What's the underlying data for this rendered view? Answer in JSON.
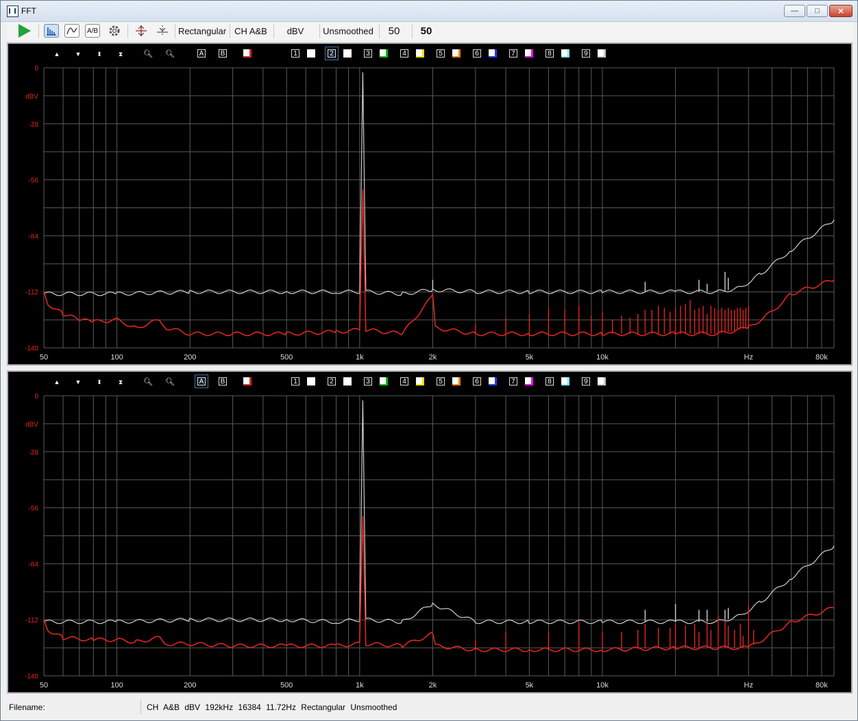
{
  "window": {
    "title": "FFT",
    "minimize": "—",
    "maximize": "□",
    "close": "✕"
  },
  "toolbar": {
    "play_icon": "play-icon",
    "window_fn": "Rectangular",
    "channel": "CH A&B",
    "units": "dBV",
    "smoothing": "Unsmoothed",
    "averages": "50",
    "averages_count": "50",
    "ab_label": "A/B"
  },
  "pane_toolbar": {
    "a": "A",
    "b": "B",
    "slots": [
      "1",
      "2",
      "3",
      "4",
      "5",
      "6",
      "7",
      "8",
      "9"
    ],
    "slot_colors": [
      "#ffffff",
      "#ffffff",
      "#00c000",
      "#f0e000",
      "#ff7f00",
      "#1e3cff",
      "#ff00ff",
      "#7fe8ff",
      "#c8c8c8"
    ]
  },
  "colors": {
    "trace_a": "#e0261f",
    "trace_b": "#cfcfcf",
    "grid": "#5a5a5a",
    "plot_bg": "#000000"
  },
  "chart_data": [
    {
      "type": "line",
      "title": "",
      "ylabel": "dBV",
      "xlabel": "Hz",
      "x_scale": "log",
      "xlim": [
        50,
        90000
      ],
      "ylim": [
        -140,
        0
      ],
      "y_ticks": [
        "0",
        "-28",
        "-56",
        "-84",
        "-112",
        "-140"
      ],
      "x_ticks": [
        "50",
        "100",
        "200",
        "500",
        "1k",
        "2k",
        "5k",
        "10k",
        "Hz",
        "80k"
      ],
      "series": [
        {
          "color": "#cfcfcf",
          "x": [
            50,
            100,
            200,
            500,
            800,
            1000,
            1030,
            1060,
            1500,
            2000,
            3000,
            5000,
            10000,
            20000,
            30000,
            37000,
            45000,
            60000,
            90000
          ],
          "y": [
            -113,
            -113,
            -112,
            -112,
            -112,
            -112,
            -2,
            -112,
            -113,
            -111,
            -112,
            -112,
            -112,
            -112,
            -112,
            -110,
            -103,
            -91,
            -76
          ],
          "spikes": [
            [
              2000,
              -106
            ],
            [
              15000,
              -107
            ],
            [
              25000,
              -106
            ],
            [
              27000,
              -108
            ],
            [
              32000,
              -102
            ],
            [
              33000,
              -105
            ]
          ]
        },
        {
          "color": "#e0261f",
          "x": [
            50,
            52,
            60,
            70,
            80,
            100,
            120,
            150,
            160,
            200,
            300,
            500,
            800,
            1000,
            1030,
            1060,
            1500,
            2000,
            2050,
            3000,
            5000,
            10000,
            20000,
            30000,
            40000,
            50000,
            60000,
            90000
          ],
          "y": [
            -112,
            -118,
            -123,
            -126,
            -127,
            -126,
            -130,
            -126,
            -130,
            -133,
            -133,
            -133,
            -132,
            -131,
            -60,
            -131,
            -133,
            -114,
            -130,
            -133,
            -133,
            -133,
            -133,
            -133,
            -130,
            -122,
            -113,
            -106
          ],
          "spikes": [
            [
              3000,
              -128
            ],
            [
              4000,
              -125
            ],
            [
              5000,
              -123
            ],
            [
              6000,
              -120
            ],
            [
              7000,
              -121
            ],
            [
              8000,
              -119
            ],
            [
              9000,
              -124
            ],
            [
              10000,
              -122
            ],
            [
              11000,
              -126
            ],
            [
              12000,
              -124
            ],
            [
              13000,
              -125
            ],
            [
              14000,
              -123
            ],
            [
              15000,
              -121
            ],
            [
              16000,
              -121
            ],
            [
              17000,
              -119
            ],
            [
              18000,
              -120
            ],
            [
              19000,
              -122
            ],
            [
              20000,
              -120
            ],
            [
              21000,
              -119
            ],
            [
              22000,
              -118
            ],
            [
              23000,
              -116
            ],
            [
              24000,
              -121
            ],
            [
              25000,
              -120
            ],
            [
              26000,
              -119
            ],
            [
              27000,
              -123
            ],
            [
              28000,
              -119
            ],
            [
              29000,
              -120
            ],
            [
              30000,
              -121
            ],
            [
              31000,
              -120
            ],
            [
              32000,
              -121
            ],
            [
              33000,
              -120
            ],
            [
              34000,
              -121
            ],
            [
              35000,
              -121
            ],
            [
              36000,
              -120
            ],
            [
              37000,
              -120
            ],
            [
              38000,
              -121
            ],
            [
              39000,
              -120
            ],
            [
              40000,
              -119
            ]
          ]
        }
      ]
    },
    {
      "type": "line",
      "title": "",
      "ylabel": "dBV",
      "xlabel": "Hz",
      "x_scale": "log",
      "xlim": [
        50,
        90000
      ],
      "ylim": [
        -140,
        0
      ],
      "y_ticks": [
        "0",
        "-28",
        "-56",
        "-84",
        "-112",
        "-140"
      ],
      "x_ticks": [
        "50",
        "100",
        "200",
        "500",
        "1k",
        "2k",
        "5k",
        "10k",
        "Hz",
        "80k"
      ],
      "series": [
        {
          "color": "#cfcfcf",
          "x": [
            50,
            100,
            200,
            500,
            800,
            1000,
            1030,
            1060,
            1500,
            2000,
            3000,
            5000,
            10000,
            20000,
            30000,
            37000,
            45000,
            60000,
            90000
          ],
          "y": [
            -113,
            -113,
            -112,
            -112,
            -113,
            -112,
            -2,
            -112,
            -113,
            -104,
            -113,
            -113,
            -113,
            -113,
            -113,
            -110,
            -103,
            -91,
            -75
          ],
          "spikes": [
            [
              15000,
              -107
            ],
            [
              20000,
              -104
            ],
            [
              25000,
              -107
            ],
            [
              27000,
              -107
            ],
            [
              32000,
              -107
            ],
            [
              33000,
              -106
            ]
          ]
        },
        {
          "color": "#e0261f",
          "x": [
            50,
            52,
            60,
            80,
            100,
            120,
            150,
            160,
            200,
            300,
            500,
            800,
            1000,
            1030,
            1060,
            1500,
            2000,
            2050,
            3000,
            5000,
            10000,
            20000,
            30000,
            40000,
            50000,
            60000,
            90000
          ],
          "y": [
            -112,
            -117,
            -121,
            -122,
            -122,
            -123,
            -121,
            -124,
            -124,
            -125,
            -125,
            -125,
            -124,
            -60,
            -124,
            -125,
            -119,
            -125,
            -127,
            -127,
            -127,
            -126,
            -126,
            -126,
            -119,
            -113,
            -106
          ],
          "spikes": [
            [
              3000,
              -122
            ],
            [
              4000,
              -118
            ],
            [
              6000,
              -118
            ],
            [
              8000,
              -113
            ],
            [
              10000,
              -118
            ],
            [
              12000,
              -118
            ],
            [
              14000,
              -117
            ],
            [
              15000,
              -114
            ],
            [
              17000,
              -116
            ],
            [
              19000,
              -116
            ],
            [
              20000,
              -114
            ],
            [
              22000,
              -115
            ],
            [
              24000,
              -114
            ],
            [
              25000,
              -118
            ],
            [
              27000,
              -114
            ],
            [
              28000,
              -117
            ],
            [
              30000,
              -110
            ],
            [
              32000,
              -112
            ],
            [
              33000,
              -115
            ],
            [
              35000,
              -117
            ],
            [
              37000,
              -114
            ],
            [
              38000,
              -120
            ],
            [
              40000,
              -105
            ],
            [
              42000,
              -117
            ]
          ]
        }
      ]
    }
  ],
  "status": {
    "filename_label": "Filename:",
    "filename": "",
    "channel": "CH A&B",
    "units": "dBV",
    "sample_rate": "192kHz",
    "fft_size": "16384",
    "resolution": "11.72Hz",
    "window_fn": "Rectangular",
    "smoothing": "Unsmoothed"
  }
}
